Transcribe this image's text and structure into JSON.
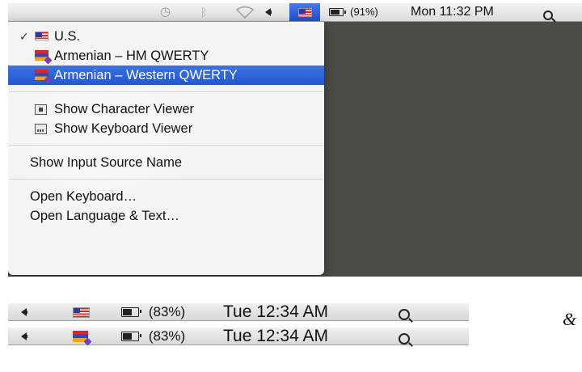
{
  "menubar_top": {
    "battery_percent": "(91%)",
    "clock": "Mon 11:32 PM",
    "icons": [
      "time-machine-icon",
      "bluetooth-icon",
      "wifi-icon",
      "volume-icon",
      "us-flag-icon",
      "battery-icon",
      "spotlight-icon"
    ]
  },
  "input_menu": {
    "sources": [
      {
        "label": "U.S.",
        "checked": true,
        "flag": "us-flag-icon"
      },
      {
        "label": "Armenian – HM QWERTY",
        "checked": false,
        "flag": "armenian-flag-icon"
      },
      {
        "label": "Armenian – Western QWERTY",
        "checked": false,
        "selected": true,
        "flag": "armenian-flag-icon"
      }
    ],
    "viewers": [
      {
        "label": "Show Character Viewer",
        "icon": "character-viewer-icon"
      },
      {
        "label": "Show Keyboard Viewer",
        "icon": "keyboard-viewer-icon"
      }
    ],
    "show_name": "Show Input Source Name",
    "prefs": [
      {
        "label": "Open Keyboard…"
      },
      {
        "label": "Open Language & Text…"
      }
    ]
  },
  "bottom_bars": [
    {
      "flag": "us-flag-icon",
      "battery_percent": "(83%)",
      "clock": "Tue 12:34 AM"
    },
    {
      "flag": "armenian-flag-icon",
      "battery_percent": "(83%)",
      "clock": "Tue 12:34 AM"
    }
  ],
  "trailing_text": "&",
  "check_mark": "✓"
}
